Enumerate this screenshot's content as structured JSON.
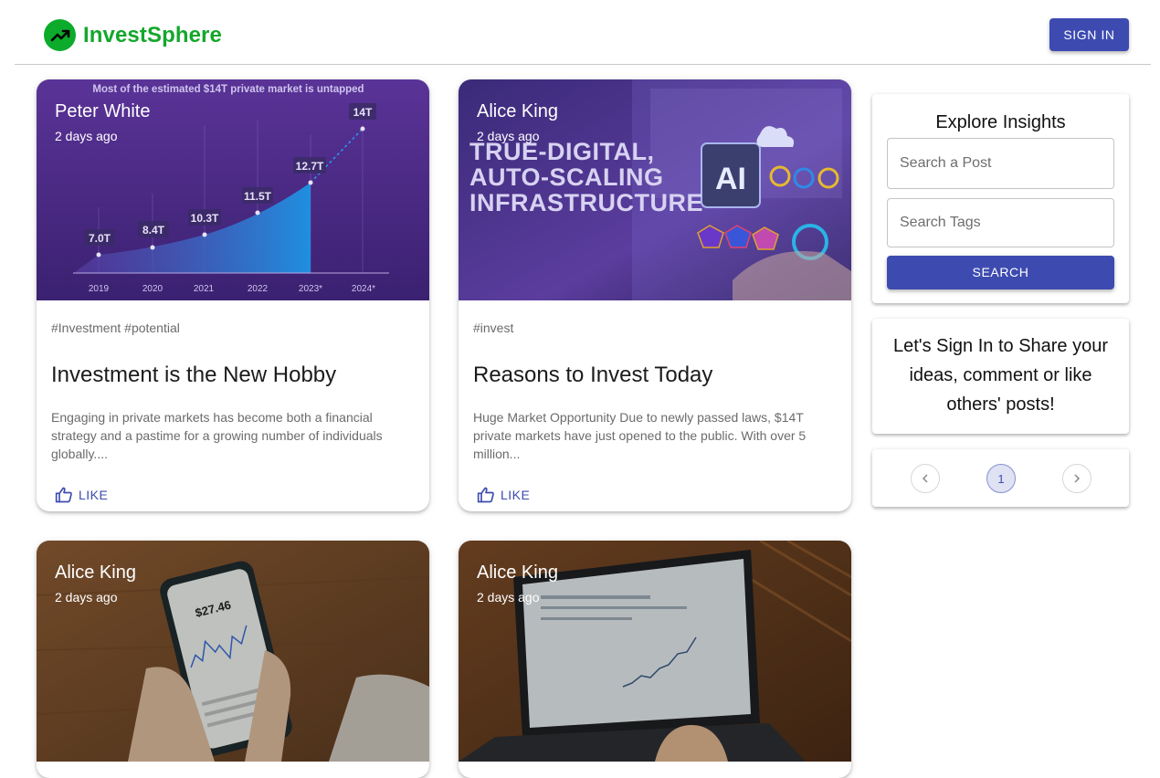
{
  "header": {
    "brand": "InvestSphere",
    "sign_in": "SIGN IN"
  },
  "posts": [
    {
      "author": "Peter White",
      "time": "2 days ago",
      "tags": "#Investment #potential",
      "title": "Investment is the New Hobby",
      "excerpt": "Engaging in private markets has become both a financial strategy and a pastime for a growing number of individuals globally....",
      "like": "LIKE",
      "image": {
        "headline": "Most of the estimated $14T private market is untapped",
        "years": [
          "2019",
          "2020",
          "2021",
          "2022",
          "2023*",
          "2024*"
        ],
        "values": [
          "7.0T",
          "8.4T",
          "10.3T",
          "11.5T",
          "12.7T",
          "14T"
        ]
      }
    },
    {
      "author": "Alice King",
      "time": "2 days ago",
      "tags": "#invest",
      "title": "Reasons to Invest Today",
      "excerpt": "Huge Market Opportunity Due to newly passed laws, $14T private markets have just opened to the public. With over 5 million...",
      "like": "LIKE",
      "image": {
        "line1": "TRUE-DIGITAL,",
        "line2": "AUTO-SCALING",
        "line3": "INFRASTRUCTURE",
        "chip": "AI"
      }
    },
    {
      "author": "Alice King",
      "time": "2 days ago",
      "image": {
        "price": "$27.46"
      }
    },
    {
      "author": "Alice King",
      "time": "2 days ago"
    }
  ],
  "sidebar": {
    "search": {
      "title": "Explore Insights",
      "post_placeholder": "Search a Post",
      "tags_placeholder": "Search Tags",
      "button": "SEARCH"
    },
    "signin_message": "Let's Sign In to Share your ideas, comment or like others' posts!",
    "pagination": {
      "current": "1"
    }
  },
  "colors": {
    "brand_green": "#14a72c",
    "primary": "#3d4bb0",
    "chart_purple": "#4b2a84"
  }
}
